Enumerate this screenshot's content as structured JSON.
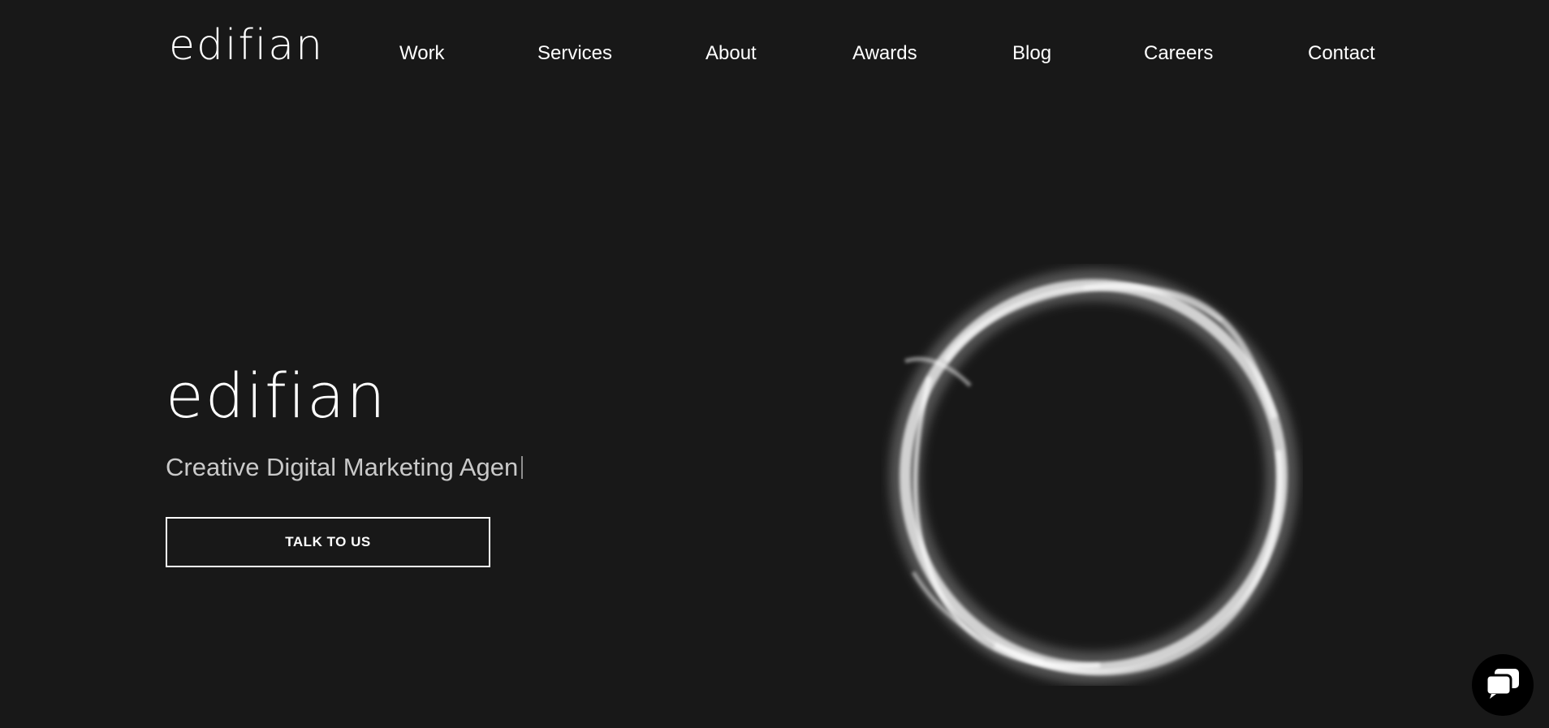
{
  "brand": {
    "logo_text": "edifian"
  },
  "nav": {
    "items": [
      {
        "label": "Work"
      },
      {
        "label": "Services"
      },
      {
        "label": "About"
      },
      {
        "label": "Awards"
      },
      {
        "label": "Blog"
      },
      {
        "label": "Careers"
      },
      {
        "label": "Contact"
      }
    ]
  },
  "hero": {
    "title": "edifian",
    "subtitle": "Creative Digital Marketing Agen",
    "cta_label": "TALK TO US"
  },
  "icons": {
    "chat": "chat-icon",
    "hero_graphic": "smoke-ring-icon"
  },
  "colors": {
    "background": "#181818",
    "text": "#ffffff",
    "subtitle": "#c9c9c9",
    "chat_bg": "#000000"
  }
}
